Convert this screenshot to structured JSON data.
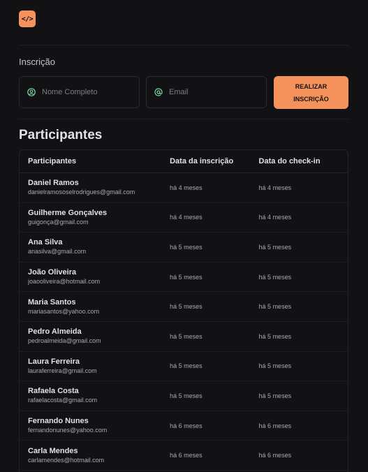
{
  "logo": {
    "glyph": "</>"
  },
  "form": {
    "section_label": "Inscrição",
    "name_placeholder": "Nome Completo",
    "email_placeholder": "Email",
    "submit_label": "REALIZAR INSCRIÇÃO"
  },
  "participants": {
    "title": "Participantes",
    "columns": [
      "Participantes",
      "Data da inscrição",
      "Data do check-in"
    ],
    "rows": [
      {
        "name": "Daniel Ramos",
        "email": "danielramososelrodrigues@gmail.com",
        "inscricao": "há 4 meses",
        "checkin": "há 4 meses"
      },
      {
        "name": "Guilherme Gonçalves",
        "email": "guigonça@gmail.com",
        "inscricao": "há 4 meses",
        "checkin": "há 4 meses"
      },
      {
        "name": "Ana Silva",
        "email": "anasilva@gmail.com",
        "inscricao": "há 5 meses",
        "checkin": "há 5 meses"
      },
      {
        "name": "João Oliveira",
        "email": "joaooliveira@hotmail.com",
        "inscricao": "há 5 meses",
        "checkin": "há 5 meses"
      },
      {
        "name": "Maria Santos",
        "email": "mariasantos@yahoo.com",
        "inscricao": "há 5 meses",
        "checkin": "há 5 meses"
      },
      {
        "name": "Pedro Almeida",
        "email": "pedroalmeida@gmail.com",
        "inscricao": "há 5 meses",
        "checkin": "há 5 meses"
      },
      {
        "name": "Laura Ferreira",
        "email": "lauraferreira@gmail.com",
        "inscricao": "há 5 meses",
        "checkin": "há 5 meses"
      },
      {
        "name": "Rafaela Costa",
        "email": "rafaelacosta@gmail.com",
        "inscricao": "há 5 meses",
        "checkin": "há 5 meses"
      },
      {
        "name": "Fernando Nunes",
        "email": "fernandonunes@yahoo.com",
        "inscricao": "há 6 meses",
        "checkin": "há 6 meses"
      },
      {
        "name": "Carla Mendes",
        "email": "carlamendes@hotmail.com",
        "inscricao": "há 6 meses",
        "checkin": "há 6 meses"
      }
    ]
  },
  "colors": {
    "background": "#121214",
    "accent": "#f5925c",
    "icon_green": "#7fd6a4",
    "border": "#29292e"
  }
}
